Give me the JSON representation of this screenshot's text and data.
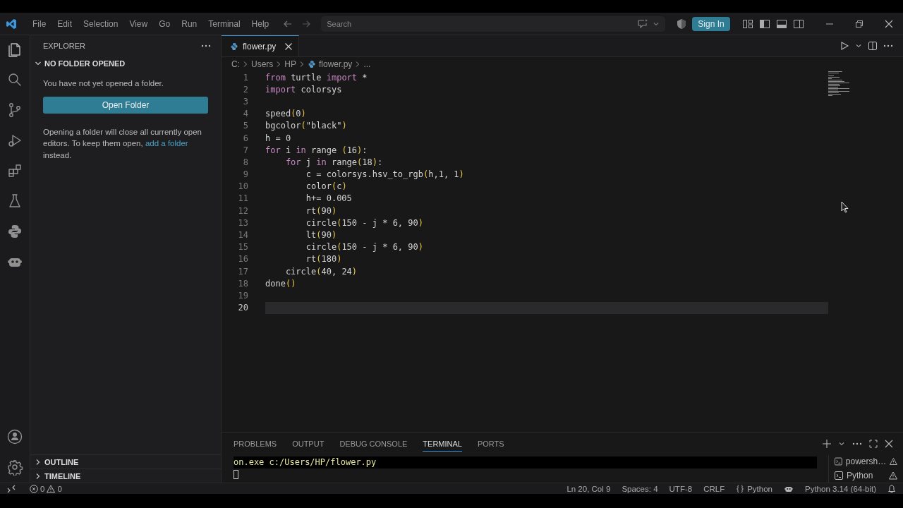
{
  "title_bar": {
    "menu": [
      "File",
      "Edit",
      "Selection",
      "View",
      "Go",
      "Run",
      "Terminal",
      "Help"
    ],
    "search": {
      "placeholder": "Search"
    },
    "sign_in": "Sign In"
  },
  "activity_bar": {
    "items": [
      {
        "kind": "files",
        "selected": true
      },
      {
        "kind": "search",
        "selected": false
      },
      {
        "kind": "branch",
        "selected": false
      },
      {
        "kind": "debug",
        "selected": false
      },
      {
        "kind": "extensions",
        "selected": false
      },
      {
        "kind": "flask",
        "selected": false
      },
      {
        "kind": "python",
        "selected": false
      },
      {
        "kind": "bot",
        "selected": false
      }
    ],
    "bottom": [
      {
        "kind": "account"
      },
      {
        "kind": "settings"
      }
    ]
  },
  "sidebar": {
    "title": "EXPLORER",
    "section": {
      "title": "NO FOLDER OPENED",
      "expanded": true
    },
    "message": "You have not yet opened a folder.",
    "button": "Open Folder",
    "note_before": "Opening a folder will close all currently open editors. To keep them open, ",
    "link": "add a folder",
    "note_after": " instead.",
    "collapsed": [
      {
        "title": "OUTLINE",
        "expanded": false
      },
      {
        "title": "TIMELINE",
        "expanded": false
      }
    ]
  },
  "editor": {
    "tabs": [
      {
        "label": "flower.py",
        "selected": true
      }
    ],
    "breadcrumb": [
      "C:",
      "Users",
      "HP",
      "flower.py",
      "..."
    ],
    "lines": [
      {
        "number": "1",
        "current": false,
        "tokens": [
          {
            "kind": "kw",
            "text": "from"
          },
          {
            "kind": "plain",
            "text": " turtle "
          },
          {
            "kind": "kw",
            "text": "import"
          },
          {
            "kind": "plain",
            "text": " *"
          }
        ]
      },
      {
        "number": "2",
        "current": false,
        "tokens": [
          {
            "kind": "kw",
            "text": "import"
          },
          {
            "kind": "plain",
            "text": " colorsys"
          }
        ]
      },
      {
        "number": "3",
        "current": false
      },
      {
        "number": "4",
        "current": false,
        "tokens": [
          {
            "kind": "plain",
            "text": "speed"
          },
          {
            "kind": "paren",
            "text": "("
          },
          {
            "kind": "plain",
            "text": "0"
          },
          {
            "kind": "paren",
            "text": ")"
          }
        ]
      },
      {
        "number": "5",
        "current": false,
        "tokens": [
          {
            "kind": "plain",
            "text": "bgcolor"
          },
          {
            "kind": "paren",
            "text": "("
          },
          {
            "kind": "plain",
            "text": "\"black\""
          },
          {
            "kind": "paren",
            "text": ")"
          }
        ]
      },
      {
        "number": "6",
        "current": false,
        "tokens": [
          {
            "kind": "plain",
            "text": "h = 0"
          }
        ]
      },
      {
        "number": "7",
        "current": false,
        "tokens": [
          {
            "kind": "kw",
            "text": "for"
          },
          {
            "kind": "plain",
            "text": " i "
          },
          {
            "kind": "kw",
            "text": "in"
          },
          {
            "kind": "plain",
            "text": " range "
          },
          {
            "kind": "paren",
            "text": "("
          },
          {
            "kind": "plain",
            "text": "16"
          },
          {
            "kind": "paren",
            "text": ")"
          },
          {
            "kind": "plain",
            "text": ":"
          }
        ]
      },
      {
        "number": "8",
        "current": false,
        "tokens": [
          {
            "kind": "kw",
            "text": "    for"
          },
          {
            "kind": "plain",
            "text": " j "
          },
          {
            "kind": "kw",
            "text": "in"
          },
          {
            "kind": "plain",
            "text": " range"
          },
          {
            "kind": "paren",
            "text": "("
          },
          {
            "kind": "plain",
            "text": "18"
          },
          {
            "kind": "paren",
            "text": ")"
          },
          {
            "kind": "plain",
            "text": ":"
          }
        ]
      },
      {
        "number": "9",
        "current": false,
        "tokens": [
          {
            "kind": "plain",
            "text": "        c = colorsys.hsv_to_rgb"
          },
          {
            "kind": "paren",
            "text": "("
          },
          {
            "kind": "plain",
            "text": "h,1, 1"
          },
          {
            "kind": "paren",
            "text": ")"
          }
        ]
      },
      {
        "number": "10",
        "current": false,
        "tokens": [
          {
            "kind": "plain",
            "text": "        color"
          },
          {
            "kind": "paren",
            "text": "("
          },
          {
            "kind": "plain",
            "text": "c"
          },
          {
            "kind": "paren",
            "text": ")"
          }
        ]
      },
      {
        "number": "11",
        "current": false,
        "tokens": [
          {
            "kind": "plain",
            "text": "        h+= 0.005"
          }
        ]
      },
      {
        "number": "12",
        "current": false,
        "tokens": [
          {
            "kind": "plain",
            "text": "        rt"
          },
          {
            "kind": "paren",
            "text": "("
          },
          {
            "kind": "plain",
            "text": "90"
          },
          {
            "kind": "paren",
            "text": ")"
          }
        ]
      },
      {
        "number": "13",
        "current": false,
        "tokens": [
          {
            "kind": "plain",
            "text": "        circle"
          },
          {
            "kind": "paren",
            "text": "("
          },
          {
            "kind": "plain",
            "text": "150 - j * 6, 90"
          },
          {
            "kind": "paren",
            "text": ")"
          }
        ]
      },
      {
        "number": "14",
        "current": false,
        "tokens": [
          {
            "kind": "plain",
            "text": "        lt"
          },
          {
            "kind": "paren",
            "text": "("
          },
          {
            "kind": "plain",
            "text": "90"
          },
          {
            "kind": "paren",
            "text": ")"
          }
        ]
      },
      {
        "number": "15",
        "current": false,
        "tokens": [
          {
            "kind": "plain",
            "text": "        circle"
          },
          {
            "kind": "paren",
            "text": "("
          },
          {
            "kind": "plain",
            "text": "150 - j * 6, 90"
          },
          {
            "kind": "paren",
            "text": ")"
          }
        ]
      },
      {
        "number": "16",
        "current": false,
        "tokens": [
          {
            "kind": "plain",
            "text": "        rt"
          },
          {
            "kind": "paren",
            "text": "("
          },
          {
            "kind": "plain",
            "text": "180"
          },
          {
            "kind": "paren",
            "text": ")"
          }
        ]
      },
      {
        "number": "17",
        "current": false,
        "tokens": [
          {
            "kind": "plain",
            "text": "    circle"
          },
          {
            "kind": "paren",
            "text": "("
          },
          {
            "kind": "plain",
            "text": "40, 24"
          },
          {
            "kind": "paren",
            "text": ")"
          }
        ]
      },
      {
        "number": "18",
        "current": false,
        "tokens": [
          {
            "kind": "plain",
            "text": "done"
          },
          {
            "kind": "paren",
            "text": "()"
          }
        ]
      },
      {
        "number": "19",
        "current": false
      },
      {
        "number": "20",
        "current": true
      }
    ]
  },
  "panel": {
    "tabs": [
      {
        "label": "PROBLEMS",
        "selected": false
      },
      {
        "label": "OUTPUT",
        "selected": false
      },
      {
        "label": "DEBUG CONSOLE",
        "selected": false
      },
      {
        "label": "TERMINAL",
        "selected": true
      },
      {
        "label": "PORTS",
        "selected": false
      }
    ],
    "terminal_lines": [
      "on.exe c:/Users/HP/flower.py"
    ],
    "terminals": [
      {
        "label": "powersh…"
      },
      {
        "label": "Python"
      }
    ]
  },
  "status_bar": {
    "errors": "0",
    "warnings": "0",
    "items": [
      {
        "kind": "text",
        "text": "Ln 20, Col 9"
      },
      {
        "kind": "text",
        "text": "Spaces: 4"
      },
      {
        "kind": "text",
        "text": "UTF-8"
      },
      {
        "kind": "text",
        "text": "CRLF"
      },
      {
        "kind": "braces",
        "text": "Python"
      },
      {
        "kind": "bot"
      },
      {
        "kind": "text",
        "text": "Python 3.14 (64-bit)"
      }
    ]
  }
}
